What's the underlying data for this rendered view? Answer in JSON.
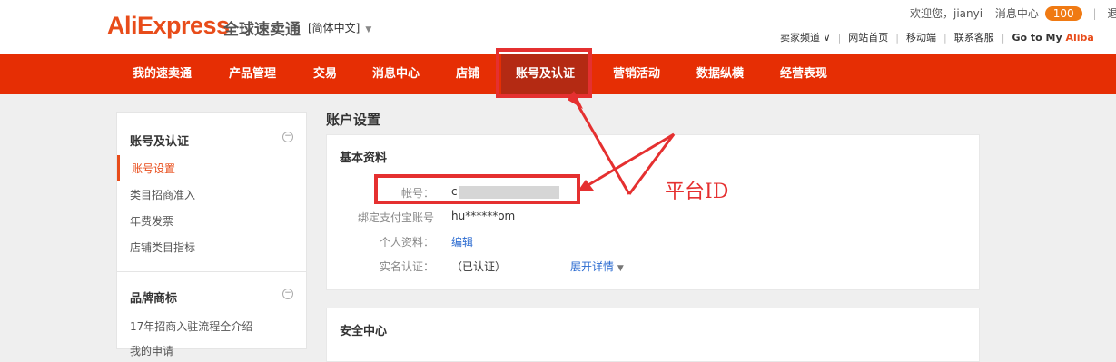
{
  "header": {
    "logo": "AliExpress",
    "logo_sub": "全球速卖通",
    "language": "[简体中文]",
    "welcome_text": "欢迎您，jianyi",
    "messages_label": "消息中心",
    "messages_count": "100",
    "logout": "退出",
    "links": [
      "卖家频道",
      "网站首页",
      "移动端",
      "联系客服"
    ],
    "goto_prefix": "Go to My ",
    "goto_brand": "Aliba"
  },
  "nav": {
    "items": [
      "我的速卖通",
      "产品管理",
      "交易",
      "消息中心",
      "店铺",
      "账号及认证",
      "营销活动",
      "数据纵横",
      "经营表现"
    ],
    "active_index": 5
  },
  "sidebar": {
    "section1_title": "账号及认证",
    "section1_items": [
      "账号设置",
      "类目招商准入",
      "年费发票",
      "店铺类目指标"
    ],
    "section2_title": "品牌商标",
    "section2_items": [
      "17年招商入驻流程全介绍",
      "我的申请"
    ]
  },
  "main": {
    "page_title": "账户设置",
    "basic_info_title": "基本资料",
    "rows": [
      {
        "label": "帐号：",
        "value": "c"
      },
      {
        "label": "绑定支付宝账号",
        "value": "hu******om"
      },
      {
        "label": "个人资料：",
        "value": "编辑"
      },
      {
        "label": "实名认证：",
        "value": "（已认证）",
        "extra": "展开详情"
      }
    ],
    "security_title": "安全中心"
  },
  "annotation": {
    "text": "平台ID",
    "color": "#e53030"
  },
  "colors": {
    "brand": "#e62e04",
    "active_nav": "#b42a13",
    "link": "#2a6ad0",
    "badge": "#f07a13"
  }
}
